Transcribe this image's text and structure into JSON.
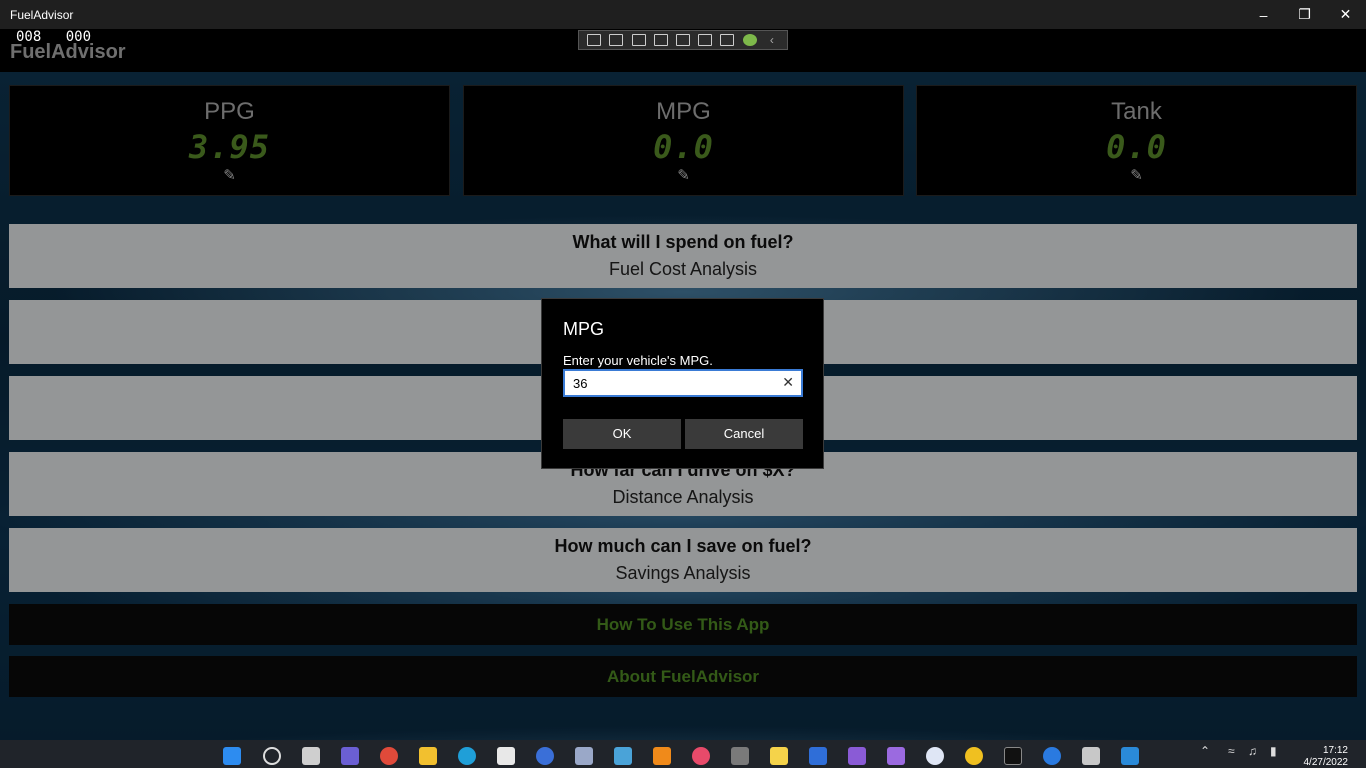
{
  "window": {
    "title": "FuelAdvisor"
  },
  "header": {
    "counter_left": "008",
    "counter_right": "000",
    "app_name": "FuelAdvisor"
  },
  "stats": [
    {
      "label": "PPG",
      "value": "3.95"
    },
    {
      "label": "MPG",
      "value": "0.0"
    },
    {
      "label": "Tank",
      "value": "0.0"
    }
  ],
  "analyses": [
    {
      "question": "What will I spend on fuel?",
      "title": "Fuel Cost Analysis"
    },
    {
      "question": "",
      "title": ""
    },
    {
      "question": "",
      "title": ""
    },
    {
      "question": "How far can I drive on $X?",
      "title": "Distance Analysis"
    },
    {
      "question": "How much can I save on fuel?",
      "title": "Savings Analysis"
    }
  ],
  "links": {
    "how_to": "How To Use This App",
    "about": "About FuelAdvisor"
  },
  "dialog": {
    "title": "MPG",
    "prompt": "Enter your vehicle's MPG.",
    "input_value": "36",
    "ok_label": "OK",
    "cancel_label": "Cancel"
  },
  "taskbar": {
    "time": "17:12",
    "date": "4/27/2022"
  },
  "colors": {
    "accent_green": "#5a8a2a",
    "link_green": "#4f8a24",
    "focus_blue": "#3a7bd5"
  }
}
